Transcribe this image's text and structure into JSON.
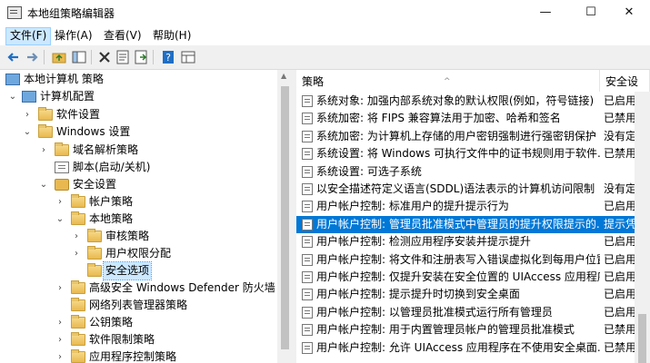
{
  "window": {
    "title": "本地组策略编辑器",
    "controls": [
      "—",
      "☐",
      "✕"
    ]
  },
  "menu": [
    {
      "label": "文件(F)"
    },
    {
      "label": "操作(A)"
    },
    {
      "label": "查看(V)"
    },
    {
      "label": "帮助(H)"
    }
  ],
  "tree": [
    {
      "label": "本地计算机 策略",
      "icon": "computer-icon"
    },
    {
      "label": "计算机配置",
      "icon": "computer-icon"
    },
    {
      "label": "软件设置",
      "icon": "folder-icon"
    },
    {
      "label": "Windows 设置",
      "icon": "folder-icon"
    },
    {
      "label": "域名解析策略",
      "icon": "folder-icon"
    },
    {
      "label": "脚本(启动/关机)",
      "icon": "script-icon"
    },
    {
      "label": "安全设置",
      "icon": "lock-icon"
    },
    {
      "label": "帐户策略",
      "icon": "folder-icon"
    },
    {
      "label": "本地策略",
      "icon": "folder-icon"
    },
    {
      "label": "审核策略",
      "icon": "folder-icon"
    },
    {
      "label": "用户权限分配",
      "icon": "folder-icon"
    },
    {
      "label": "安全选项",
      "icon": "folder-icon"
    },
    {
      "label": "高级安全 Windows Defender 防火墙",
      "icon": "folder-icon"
    },
    {
      "label": "网络列表管理器策略",
      "icon": "folder-icon"
    },
    {
      "label": "公钥策略",
      "icon": "folder-icon"
    },
    {
      "label": "软件限制策略",
      "icon": "folder-icon"
    },
    {
      "label": "应用程序控制策略",
      "icon": "folder-icon"
    }
  ],
  "columns": {
    "policy": "策略",
    "setting": "安全设"
  },
  "policies": [
    {
      "name": "系统对象: 加强内部系统对象的默认权限(例如，符号链接)",
      "setting": "已启用"
    },
    {
      "name": "系统加密: 将 FIPS 兼容算法用于加密、哈希和签名",
      "setting": "已禁用"
    },
    {
      "name": "系统加密: 为计算机上存储的用户密钥强制进行强密钥保护",
      "setting": "没有定"
    },
    {
      "name": "系统设置: 将 Windows 可执行文件中的证书规则用于软件...",
      "setting": "已禁用"
    },
    {
      "name": "系统设置: 可选子系统",
      "setting": ""
    },
    {
      "name": "以安全描述符定义语言(SDDL)语法表示的计算机访问限制",
      "setting": "没有定"
    },
    {
      "name": "用户帐户控制: 标准用户的提升提示行为",
      "setting": "已启用"
    },
    {
      "name": "用户帐户控制: 管理员批准模式中管理员的提升权限提示的...",
      "setting": "提示凭"
    },
    {
      "name": "用户帐户控制: 检测应用程序安装并提示提升",
      "setting": "已启用"
    },
    {
      "name": "用户帐户控制: 将文件和注册表写入错误虚拟化到每用户位置",
      "setting": "已启用"
    },
    {
      "name": "用户帐户控制: 仅提升安装在安全位置的 UIAccess 应用程序",
      "setting": "已启用"
    },
    {
      "name": "用户帐户控制: 提示提升时切换到安全桌面",
      "setting": "已启用"
    },
    {
      "name": "用户帐户控制: 以管理员批准模式运行所有管理员",
      "setting": "已启用"
    },
    {
      "name": "用户帐户控制: 用于内置管理员帐户的管理员批准模式",
      "setting": "已禁用"
    },
    {
      "name": "用户帐户控制: 允许 UIAccess 应用程序在不使用安全桌面...",
      "setting": "已禁用"
    }
  ],
  "colors": {
    "selection": "#0078d7",
    "tree_selection": "#cce8ff",
    "accent": "#3399ff"
  }
}
